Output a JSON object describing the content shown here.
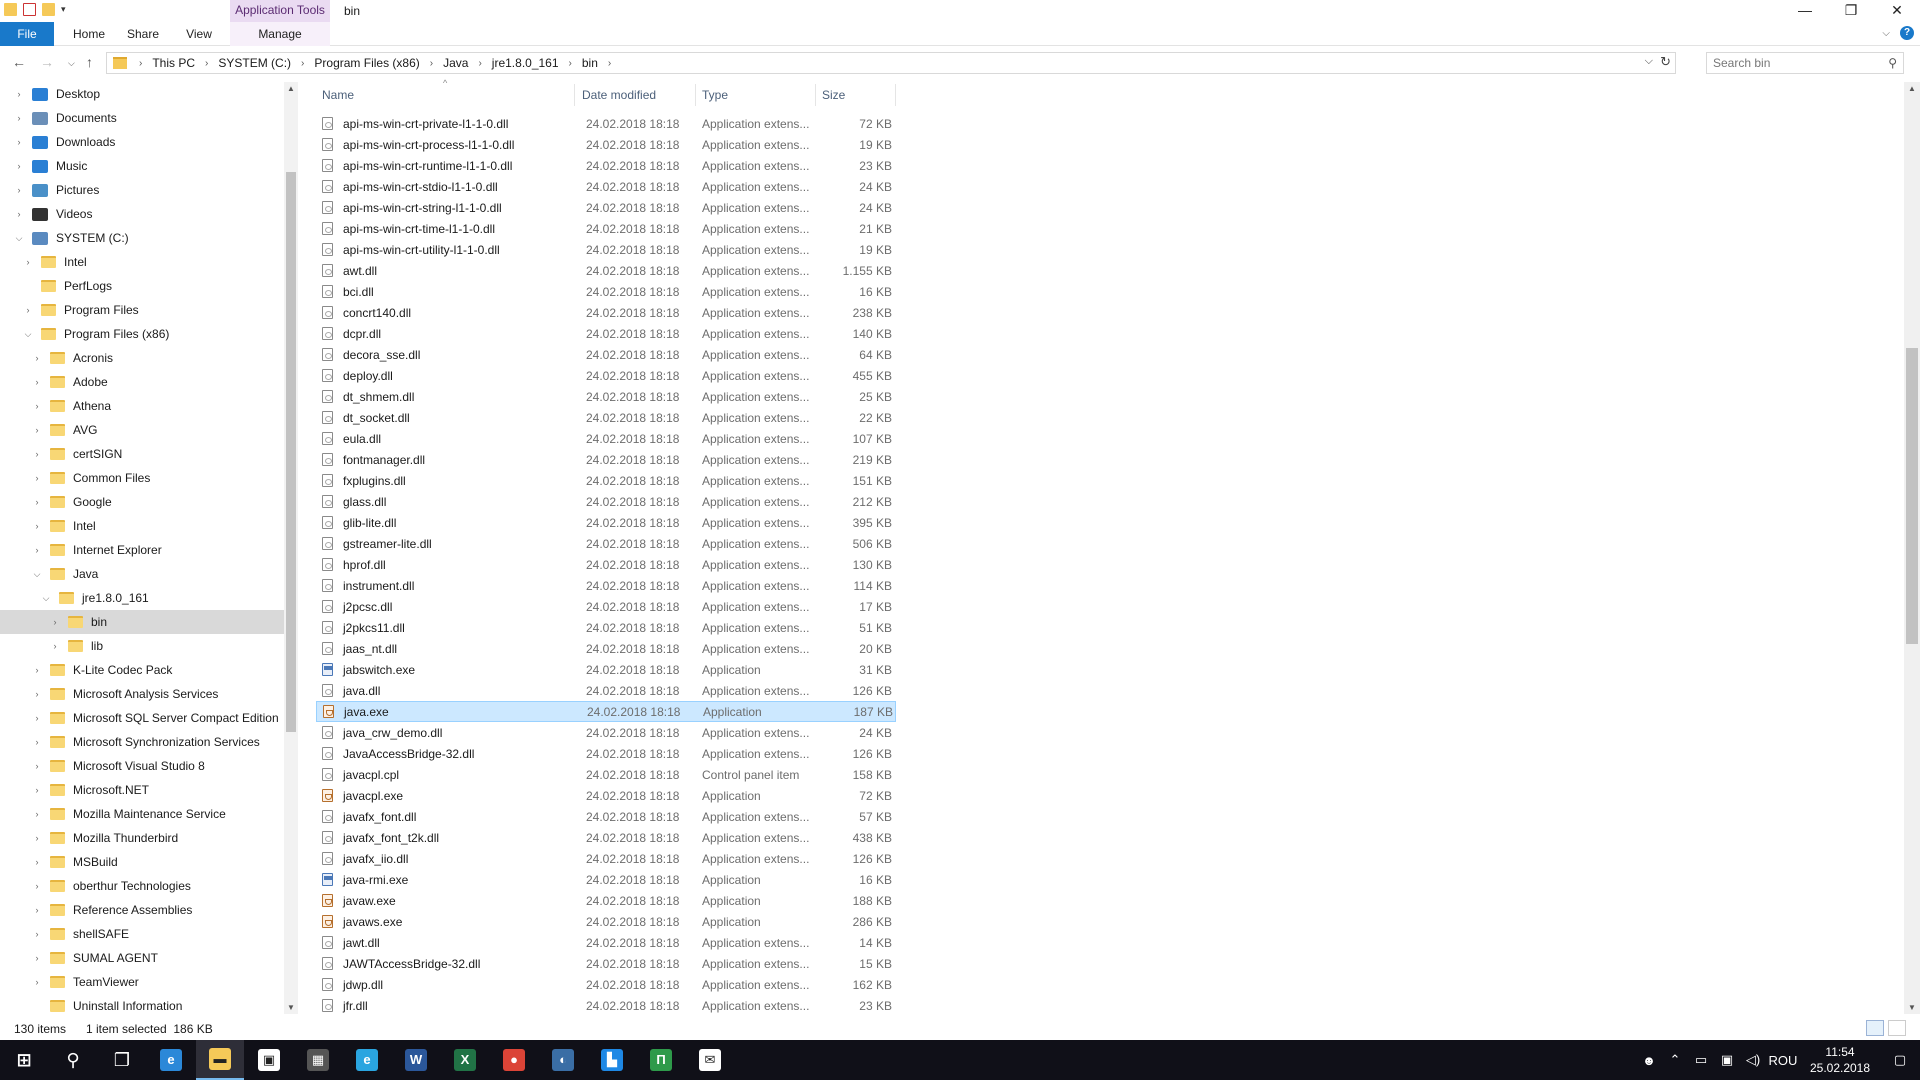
{
  "window": {
    "title": "bin",
    "context_tab_group": "Application Tools",
    "controls": {
      "minimize": "—",
      "maximize": "❐",
      "close": "✕"
    }
  },
  "ribbon": {
    "tabs": [
      {
        "label": "File"
      },
      {
        "label": "Home"
      },
      {
        "label": "Share"
      },
      {
        "label": "View"
      }
    ],
    "context_tab": "Manage"
  },
  "address": {
    "crumbs": [
      "This PC",
      "SYSTEM (C:)",
      "Program Files (x86)",
      "Java",
      "jre1.8.0_161",
      "bin"
    ]
  },
  "search": {
    "placeholder": "Search bin"
  },
  "nav_tree": [
    {
      "label": "Desktop",
      "level": 0,
      "icon": "desktop-icon",
      "color": "#2a7fd4"
    },
    {
      "label": "Documents",
      "level": 0,
      "icon": "documents-icon",
      "color": "#6b8fb8"
    },
    {
      "label": "Downloads",
      "level": 0,
      "icon": "downloads-icon",
      "color": "#2a7fd4"
    },
    {
      "label": "Music",
      "level": 0,
      "icon": "music-icon",
      "color": "#2a7fd4"
    },
    {
      "label": "Pictures",
      "level": 0,
      "icon": "pictures-icon",
      "color": "#4a90c8"
    },
    {
      "label": "Videos",
      "level": 0,
      "icon": "videos-icon",
      "color": "#333333"
    },
    {
      "label": "SYSTEM (C:)",
      "level": 0,
      "icon": "drive-icon",
      "color": "#5a8ac0",
      "expanded": true
    },
    {
      "label": "Intel",
      "level": 1,
      "icon": "folder-icon"
    },
    {
      "label": "PerfLogs",
      "level": 1,
      "icon": "folder-icon",
      "leaf": true
    },
    {
      "label": "Program Files",
      "level": 1,
      "icon": "folder-icon"
    },
    {
      "label": "Program Files (x86)",
      "level": 1,
      "icon": "folder-icon",
      "expanded": true
    },
    {
      "label": "Acronis",
      "level": 2,
      "icon": "folder-icon"
    },
    {
      "label": "Adobe",
      "level": 2,
      "icon": "folder-icon"
    },
    {
      "label": "Athena",
      "level": 2,
      "icon": "folder-icon"
    },
    {
      "label": "AVG",
      "level": 2,
      "icon": "folder-icon"
    },
    {
      "label": "certSIGN",
      "level": 2,
      "icon": "folder-icon"
    },
    {
      "label": "Common Files",
      "level": 2,
      "icon": "folder-icon"
    },
    {
      "label": "Google",
      "level": 2,
      "icon": "folder-icon"
    },
    {
      "label": "Intel",
      "level": 2,
      "icon": "folder-icon"
    },
    {
      "label": "Internet Explorer",
      "level": 2,
      "icon": "folder-icon"
    },
    {
      "label": "Java",
      "level": 2,
      "icon": "folder-icon",
      "expanded": true
    },
    {
      "label": "jre1.8.0_161",
      "level": 3,
      "icon": "folder-icon",
      "expanded": true
    },
    {
      "label": "bin",
      "level": 4,
      "icon": "folder-icon",
      "selected": true
    },
    {
      "label": "lib",
      "level": 4,
      "icon": "folder-icon"
    },
    {
      "label": "K-Lite Codec Pack",
      "level": 2,
      "icon": "folder-icon"
    },
    {
      "label": "Microsoft Analysis Services",
      "level": 2,
      "icon": "folder-icon"
    },
    {
      "label": "Microsoft SQL Server Compact Edition",
      "level": 2,
      "icon": "folder-icon"
    },
    {
      "label": "Microsoft Synchronization Services",
      "level": 2,
      "icon": "folder-icon"
    },
    {
      "label": "Microsoft Visual Studio 8",
      "level": 2,
      "icon": "folder-icon"
    },
    {
      "label": "Microsoft.NET",
      "level": 2,
      "icon": "folder-icon"
    },
    {
      "label": "Mozilla Maintenance Service",
      "level": 2,
      "icon": "folder-icon"
    },
    {
      "label": "Mozilla Thunderbird",
      "level": 2,
      "icon": "folder-icon"
    },
    {
      "label": "MSBuild",
      "level": 2,
      "icon": "folder-icon"
    },
    {
      "label": "oberthur Technologies",
      "level": 2,
      "icon": "folder-icon"
    },
    {
      "label": "Reference Assemblies",
      "level": 2,
      "icon": "folder-icon"
    },
    {
      "label": "shellSAFE",
      "level": 2,
      "icon": "folder-icon"
    },
    {
      "label": "SUMAL AGENT",
      "level": 2,
      "icon": "folder-icon"
    },
    {
      "label": "TeamViewer",
      "level": 2,
      "icon": "folder-icon"
    },
    {
      "label": "Uninstall Information",
      "level": 2,
      "icon": "folder-icon",
      "leaf": true
    }
  ],
  "columns": {
    "name": "Name",
    "date": "Date modified",
    "type": "Type",
    "size": "Size"
  },
  "files": [
    {
      "name": "api-ms-win-crt-private-l1-1-0.dll",
      "date": "24.02.2018 18:18",
      "type": "Application extens...",
      "size": "72 KB",
      "kind": "dll"
    },
    {
      "name": "api-ms-win-crt-process-l1-1-0.dll",
      "date": "24.02.2018 18:18",
      "type": "Application extens...",
      "size": "19 KB",
      "kind": "dll"
    },
    {
      "name": "api-ms-win-crt-runtime-l1-1-0.dll",
      "date": "24.02.2018 18:18",
      "type": "Application extens...",
      "size": "23 KB",
      "kind": "dll"
    },
    {
      "name": "api-ms-win-crt-stdio-l1-1-0.dll",
      "date": "24.02.2018 18:18",
      "type": "Application extens...",
      "size": "24 KB",
      "kind": "dll"
    },
    {
      "name": "api-ms-win-crt-string-l1-1-0.dll",
      "date": "24.02.2018 18:18",
      "type": "Application extens...",
      "size": "24 KB",
      "kind": "dll"
    },
    {
      "name": "api-ms-win-crt-time-l1-1-0.dll",
      "date": "24.02.2018 18:18",
      "type": "Application extens...",
      "size": "21 KB",
      "kind": "dll"
    },
    {
      "name": "api-ms-win-crt-utility-l1-1-0.dll",
      "date": "24.02.2018 18:18",
      "type": "Application extens...",
      "size": "19 KB",
      "kind": "dll"
    },
    {
      "name": "awt.dll",
      "date": "24.02.2018 18:18",
      "type": "Application extens...",
      "size": "1.155 KB",
      "kind": "dll"
    },
    {
      "name": "bci.dll",
      "date": "24.02.2018 18:18",
      "type": "Application extens...",
      "size": "16 KB",
      "kind": "dll"
    },
    {
      "name": "concrt140.dll",
      "date": "24.02.2018 18:18",
      "type": "Application extens...",
      "size": "238 KB",
      "kind": "dll"
    },
    {
      "name": "dcpr.dll",
      "date": "24.02.2018 18:18",
      "type": "Application extens...",
      "size": "140 KB",
      "kind": "dll"
    },
    {
      "name": "decora_sse.dll",
      "date": "24.02.2018 18:18",
      "type": "Application extens...",
      "size": "64 KB",
      "kind": "dll"
    },
    {
      "name": "deploy.dll",
      "date": "24.02.2018 18:18",
      "type": "Application extens...",
      "size": "455 KB",
      "kind": "dll"
    },
    {
      "name": "dt_shmem.dll",
      "date": "24.02.2018 18:18",
      "type": "Application extens...",
      "size": "25 KB",
      "kind": "dll"
    },
    {
      "name": "dt_socket.dll",
      "date": "24.02.2018 18:18",
      "type": "Application extens...",
      "size": "22 KB",
      "kind": "dll"
    },
    {
      "name": "eula.dll",
      "date": "24.02.2018 18:18",
      "type": "Application extens...",
      "size": "107 KB",
      "kind": "dll"
    },
    {
      "name": "fontmanager.dll",
      "date": "24.02.2018 18:18",
      "type": "Application extens...",
      "size": "219 KB",
      "kind": "dll"
    },
    {
      "name": "fxplugins.dll",
      "date": "24.02.2018 18:18",
      "type": "Application extens...",
      "size": "151 KB",
      "kind": "dll"
    },
    {
      "name": "glass.dll",
      "date": "24.02.2018 18:18",
      "type": "Application extens...",
      "size": "212 KB",
      "kind": "dll"
    },
    {
      "name": "glib-lite.dll",
      "date": "24.02.2018 18:18",
      "type": "Application extens...",
      "size": "395 KB",
      "kind": "dll"
    },
    {
      "name": "gstreamer-lite.dll",
      "date": "24.02.2018 18:18",
      "type": "Application extens...",
      "size": "506 KB",
      "kind": "dll"
    },
    {
      "name": "hprof.dll",
      "date": "24.02.2018 18:18",
      "type": "Application extens...",
      "size": "130 KB",
      "kind": "dll"
    },
    {
      "name": "instrument.dll",
      "date": "24.02.2018 18:18",
      "type": "Application extens...",
      "size": "114 KB",
      "kind": "dll"
    },
    {
      "name": "j2pcsc.dll",
      "date": "24.02.2018 18:18",
      "type": "Application extens...",
      "size": "17 KB",
      "kind": "dll"
    },
    {
      "name": "j2pkcs11.dll",
      "date": "24.02.2018 18:18",
      "type": "Application extens...",
      "size": "51 KB",
      "kind": "dll"
    },
    {
      "name": "jaas_nt.dll",
      "date": "24.02.2018 18:18",
      "type": "Application extens...",
      "size": "20 KB",
      "kind": "dll"
    },
    {
      "name": "jabswitch.exe",
      "date": "24.02.2018 18:18",
      "type": "Application",
      "size": "31 KB",
      "kind": "exe"
    },
    {
      "name": "java.dll",
      "date": "24.02.2018 18:18",
      "type": "Application extens...",
      "size": "126 KB",
      "kind": "dll"
    },
    {
      "name": "java.exe",
      "date": "24.02.2018 18:18",
      "type": "Application",
      "size": "187 KB",
      "kind": "java",
      "selected": true
    },
    {
      "name": "java_crw_demo.dll",
      "date": "24.02.2018 18:18",
      "type": "Application extens...",
      "size": "24 KB",
      "kind": "dll"
    },
    {
      "name": "JavaAccessBridge-32.dll",
      "date": "24.02.2018 18:18",
      "type": "Application extens...",
      "size": "126 KB",
      "kind": "dll"
    },
    {
      "name": "javacpl.cpl",
      "date": "24.02.2018 18:18",
      "type": "Control panel item",
      "size": "158 KB",
      "kind": "dll"
    },
    {
      "name": "javacpl.exe",
      "date": "24.02.2018 18:18",
      "type": "Application",
      "size": "72 KB",
      "kind": "java"
    },
    {
      "name": "javafx_font.dll",
      "date": "24.02.2018 18:18",
      "type": "Application extens...",
      "size": "57 KB",
      "kind": "dll"
    },
    {
      "name": "javafx_font_t2k.dll",
      "date": "24.02.2018 18:18",
      "type": "Application extens...",
      "size": "438 KB",
      "kind": "dll"
    },
    {
      "name": "javafx_iio.dll",
      "date": "24.02.2018 18:18",
      "type": "Application extens...",
      "size": "126 KB",
      "kind": "dll"
    },
    {
      "name": "java-rmi.exe",
      "date": "24.02.2018 18:18",
      "type": "Application",
      "size": "16 KB",
      "kind": "exe"
    },
    {
      "name": "javaw.exe",
      "date": "24.02.2018 18:18",
      "type": "Application",
      "size": "188 KB",
      "kind": "java"
    },
    {
      "name": "javaws.exe",
      "date": "24.02.2018 18:18",
      "type": "Application",
      "size": "286 KB",
      "kind": "java"
    },
    {
      "name": "jawt.dll",
      "date": "24.02.2018 18:18",
      "type": "Application extens...",
      "size": "14 KB",
      "kind": "dll"
    },
    {
      "name": "JAWTAccessBridge-32.dll",
      "date": "24.02.2018 18:18",
      "type": "Application extens...",
      "size": "15 KB",
      "kind": "dll"
    },
    {
      "name": "jdwp.dll",
      "date": "24.02.2018 18:18",
      "type": "Application extens...",
      "size": "162 KB",
      "kind": "dll"
    },
    {
      "name": "jfr.dll",
      "date": "24.02.2018 18:18",
      "type": "Application extens...",
      "size": "23 KB",
      "kind": "dll"
    }
  ],
  "status": {
    "items": "130 items",
    "selected": "1 item selected  186 KB"
  },
  "taskbar": {
    "apps": [
      {
        "name": "start-button",
        "glyph": "⊞",
        "color": "#ffffff"
      },
      {
        "name": "search-button",
        "glyph": "⚲",
        "color": "#ffffff"
      },
      {
        "name": "task-view-button",
        "glyph": "❐",
        "color": "#ffffff"
      },
      {
        "name": "edge-app",
        "glyph": "e",
        "color": "#2b88d8"
      },
      {
        "name": "file-explorer-app",
        "glyph": "▬",
        "color": "#f5c958",
        "active": true
      },
      {
        "name": "store-app",
        "glyph": "▣",
        "color": "#ffffff"
      },
      {
        "name": "calculator-app",
        "glyph": "▦",
        "color": "#555555"
      },
      {
        "name": "internet-explorer-app",
        "glyph": "e",
        "color": "#2aa5e0"
      },
      {
        "name": "word-app",
        "glyph": "W",
        "color": "#2b579a"
      },
      {
        "name": "excel-app",
        "glyph": "X",
        "color": "#217346"
      },
      {
        "name": "chrome-app",
        "glyph": "●",
        "color": "#db4437"
      },
      {
        "name": "vpn-app",
        "glyph": "◐",
        "color": "#3a6ea5"
      },
      {
        "name": "chart-app",
        "glyph": "▙",
        "color": "#1e88e5"
      },
      {
        "name": "project-app",
        "glyph": "П",
        "color": "#2e9a4a"
      },
      {
        "name": "mail-app",
        "glyph": "✉",
        "color": "#ffffff"
      }
    ],
    "tray": {
      "language": "ROU",
      "time": "11:54",
      "date": "25.02.2018"
    }
  }
}
